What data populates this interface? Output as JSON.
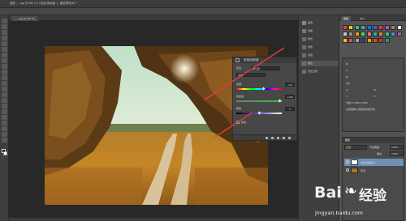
{
  "titlebar": {
    "document_title": "图层 … jpg @ 66.7% (色相/饱和度 1, 图层蒙版/8) *"
  },
  "canvas": {
    "tab_label": "……jpg @ 66.7%"
  },
  "properties_panel": {
    "title": "色相/饱和度",
    "preset_label": "预设:",
    "preset_value": "默认值",
    "channel_value": "全图",
    "hue_label": "色相:",
    "hue_value": "+70",
    "saturation_label": "饱和度:",
    "saturation_value": "+100",
    "lightness_label": "明度:",
    "lightness_value": "0",
    "colorize_label": "着色",
    "slider_fractions": {
      "hue": 0.6,
      "saturation": 0.96,
      "lightness": 0.5
    }
  },
  "mini_panel": {
    "items": [
      {
        "label": "颜色",
        "color": "#8a8a8a"
      },
      {
        "label": "色板",
        "color": "#7a7a7a"
      },
      {
        "label": "样式",
        "color": "#6f6f6f"
      },
      {
        "label": "调整",
        "color": "#6f6f6f"
      },
      {
        "label": "通道",
        "color": "#6f6f6f"
      },
      {
        "label": "属性",
        "color": "#6f6f6f"
      },
      {
        "label": "历史记录",
        "color": "#6f6f6f"
      }
    ],
    "active_index": 5
  },
  "right_panel": {
    "tabs": [
      "色板",
      "信息"
    ],
    "swatch_colors": [
      "#ff3b30",
      "#ffcc00",
      "#34c759",
      "#30b0c7",
      "#007aff",
      "#5856d6",
      "#ff2d55",
      "#af52de",
      "#a2845e",
      "#ffffff",
      "#c7c7cc",
      "#8e8e93",
      "#ff9500",
      "#4cd964",
      "#ff6b6b",
      "#1abc9c",
      "#e67e22",
      "#2ecc71",
      "#3498db",
      "#9b59b6",
      "#f1c40f",
      "#e74c3c",
      "#95a5a6",
      "#34495e",
      "#f39c12",
      "#d35400",
      "#c0392b",
      "#16a085"
    ],
    "info_lines": [
      {
        "label": "R:",
        "value": ""
      },
      {
        "label": "G:",
        "value": ""
      },
      {
        "label": "B:",
        "value": ""
      },
      {
        "label": "8位",
        "value": ""
      },
      {
        "label": "X:",
        "value": "W:"
      },
      {
        "label": "Y:",
        "value": "H:"
      },
      {
        "label": "文档:2.40M/2.40M",
        "value": ""
      },
      {
        "label": "点按图像以选取新的前景色",
        "value": ""
      }
    ]
  },
  "layers_panel": {
    "title": "图层",
    "blend_mode": "正常",
    "opacity_label": "不透明度:",
    "opacity_value": "100%",
    "fill_label": "填充:",
    "fill_value": "100%",
    "layers": [
      {
        "name": "色相/饱和度 1",
        "selected": true
      },
      {
        "name": "背景",
        "selected": false
      }
    ]
  },
  "watermark": {
    "brand": "Bai",
    "paw": "❧",
    "brand2": "经验",
    "url": "jingyan.baidu.com"
  },
  "annotations": {
    "arrow_color": "#e23a3a"
  }
}
